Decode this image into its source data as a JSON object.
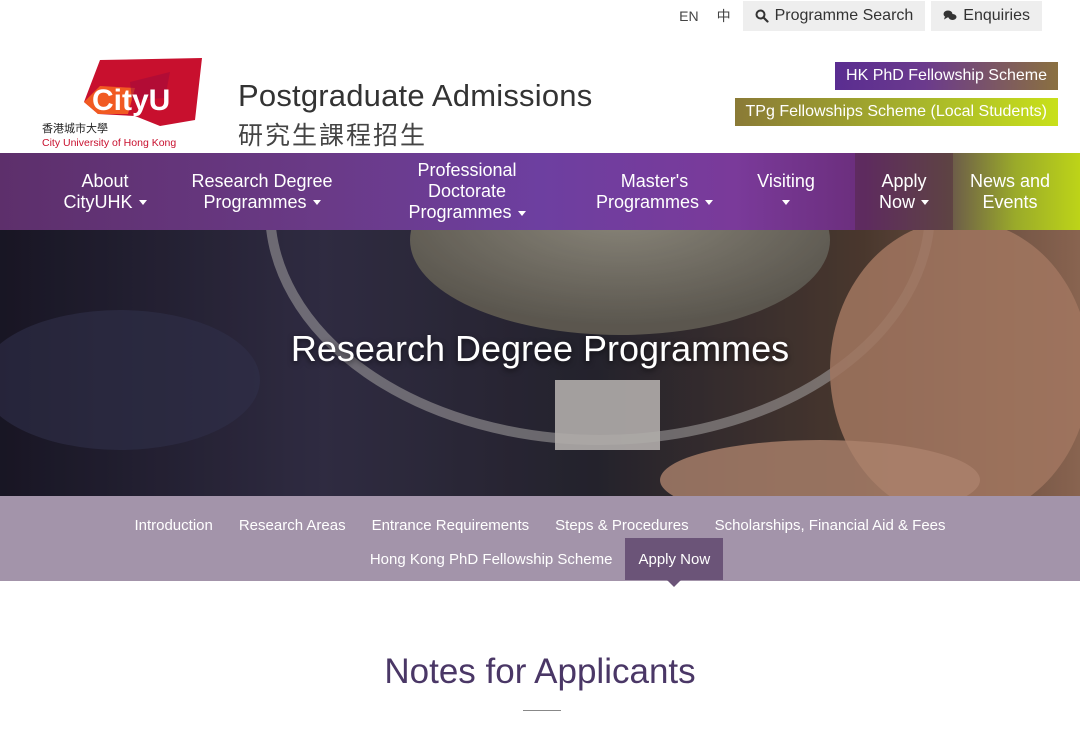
{
  "topbar": {
    "lang_en": "EN",
    "lang_zh": "中",
    "search_label": "Programme Search",
    "enquiries_label": "Enquiries"
  },
  "header": {
    "logo_text": "CityU",
    "logo_zh": "香港城市大學",
    "logo_en": "City University of Hong Kong",
    "title_en": "Postgraduate Admissions",
    "title_zh": "研究生課程招生",
    "fellowship1": "HK PhD Fellowship Scheme",
    "fellowship2": "TPg Fellowships Scheme (Local Students)"
  },
  "nav": {
    "items": [
      {
        "line1": "About",
        "line2": "CityUHK"
      },
      {
        "line1": "Research Degree",
        "line2": "Programmes"
      },
      {
        "line1": "Professional",
        "line2": "Doctorate",
        "line3": "Programmes"
      },
      {
        "line1": "Master's",
        "line2": "Programmes"
      },
      {
        "line1": "Visiting",
        "line2": ""
      },
      {
        "line1": "Apply",
        "line2": "Now"
      },
      {
        "line1": "News and",
        "line2": "Events"
      }
    ]
  },
  "hero": {
    "title": "Research Degree Programmes"
  },
  "subnav": {
    "row1": [
      "Introduction",
      "Research Areas",
      "Entrance Requirements",
      "Steps & Procedures",
      "Scholarships, Financial Aid & Fees"
    ],
    "row2": [
      "Hong Kong PhD Fellowship Scheme",
      "Apply Now"
    ]
  },
  "content": {
    "heading": "Notes for Applicants"
  },
  "colors": {
    "nav_purple": "#6d3fa0",
    "nav_green": "#bdd418",
    "subnav": "#a394aa",
    "active_tab": "#6b5478",
    "heading": "#4a3766",
    "logo_red": "#c8102e"
  }
}
